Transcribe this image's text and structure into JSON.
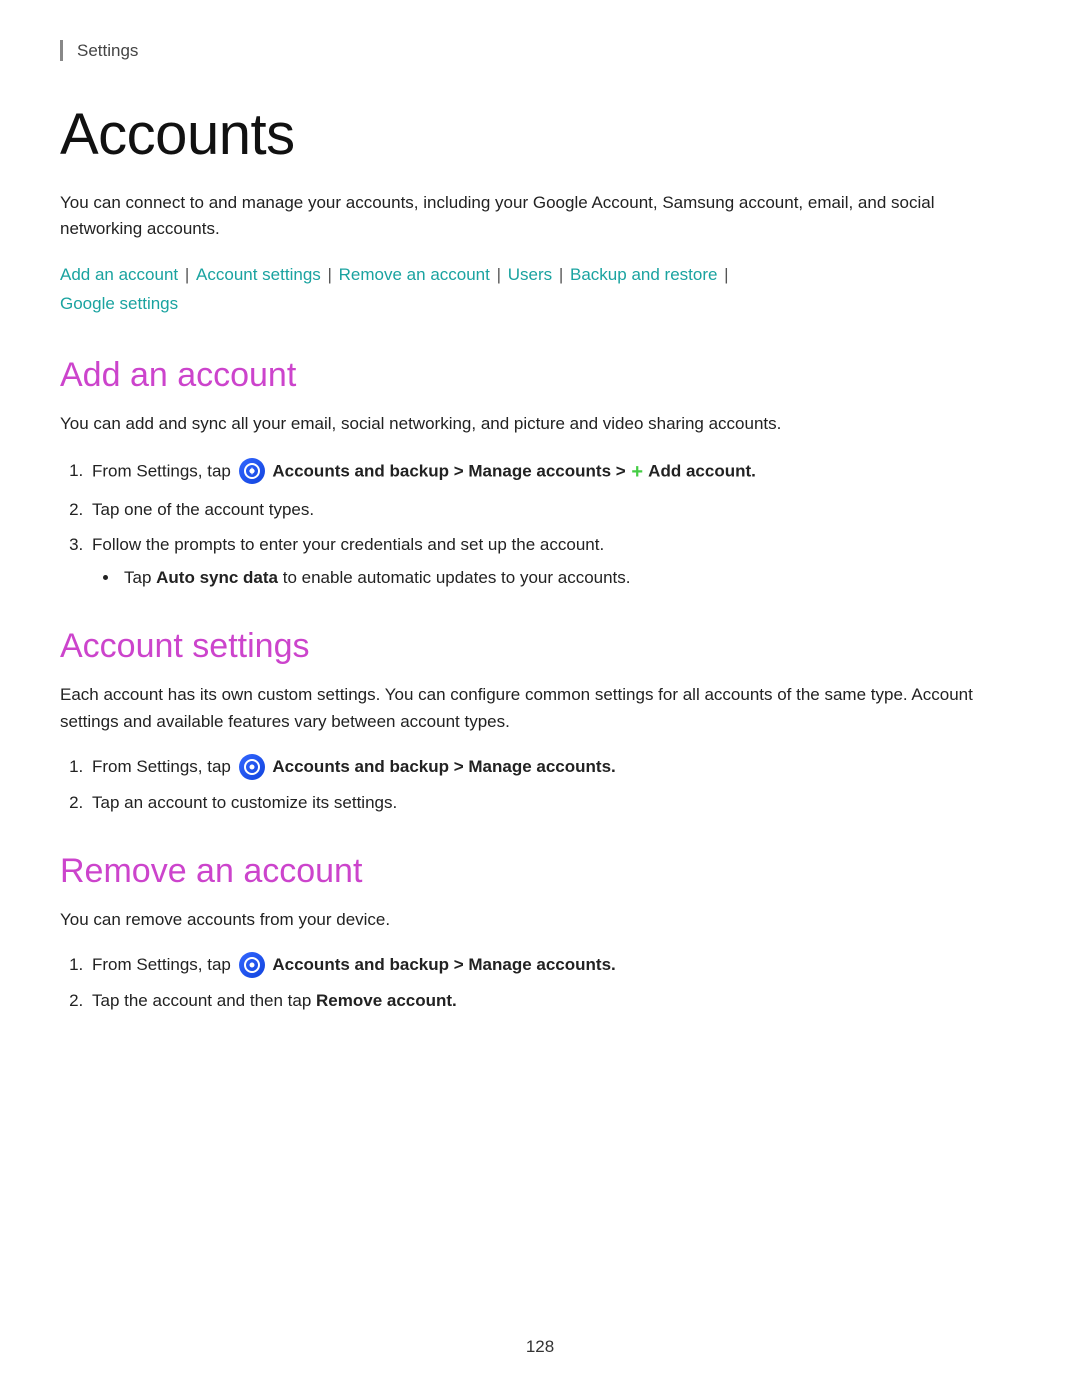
{
  "settings_label": "Settings",
  "page_title": "Accounts",
  "intro_text": "You can connect to and manage your accounts, including your Google Account, Samsung account, email, and social networking accounts.",
  "quick_links": {
    "add_account": "Add an account",
    "account_settings": "Account settings",
    "remove_account": "Remove an account",
    "users": "Users",
    "backup_restore": "Backup and restore",
    "google_settings": "Google settings"
  },
  "sections": [
    {
      "id": "add-account",
      "title": "Add an account",
      "intro": "You can add and sync all your email, social networking, and picture and video sharing accounts.",
      "steps": [
        {
          "text_before": "From Settings, tap",
          "icon": "accounts-icon",
          "bold": "Accounts and backup > Manage accounts >",
          "plus": true,
          "bold2": "Add account."
        },
        {
          "text": "Tap one of the account types."
        },
        {
          "text": "Follow the prompts to enter your credentials and set up the account.",
          "sub": [
            {
              "text_before": "Tap",
              "bold": "Auto sync data",
              "text_after": "to enable automatic updates to your accounts."
            }
          ]
        }
      ]
    },
    {
      "id": "account-settings",
      "title": "Account settings",
      "intro": "Each account has its own custom settings. You can configure common settings for all accounts of the same type. Account settings and available features vary between account types.",
      "steps": [
        {
          "text_before": "From Settings, tap",
          "icon": "accounts-icon",
          "bold": "Accounts and backup > Manage accounts."
        },
        {
          "text": "Tap an account to customize its settings."
        }
      ]
    },
    {
      "id": "remove-account",
      "title": "Remove an account",
      "intro": "You can remove accounts from your device.",
      "steps": [
        {
          "text_before": "From Settings, tap",
          "icon": "accounts-icon",
          "bold": "Accounts and backup > Manage accounts."
        },
        {
          "text_before": "Tap the account and then tap",
          "bold": "Remove account."
        }
      ]
    }
  ],
  "page_number": "128"
}
